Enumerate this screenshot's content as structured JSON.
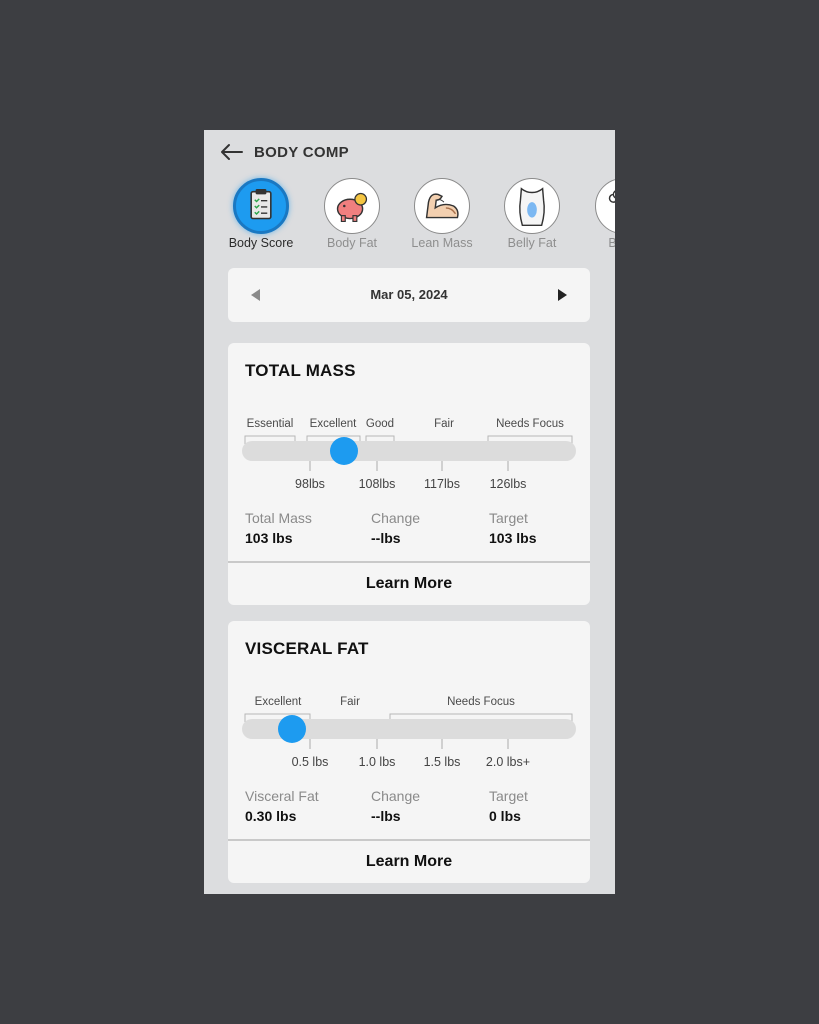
{
  "header": {
    "title": "BODY COMP",
    "back_icon": "arrow-left-icon"
  },
  "tabs": [
    {
      "label": "Body Score",
      "icon": "clipboard-checklist-icon",
      "active": true
    },
    {
      "label": "Body Fat",
      "icon": "piggy-bank-icon",
      "active": false
    },
    {
      "label": "Lean Mass",
      "icon": "flexed-arm-icon",
      "active": false
    },
    {
      "label": "Belly Fat",
      "icon": "torso-icon",
      "active": false
    },
    {
      "label": "Bone",
      "icon": "bone-icon",
      "active": false
    }
  ],
  "date_nav": {
    "date": "Mar 05, 2024",
    "prev_icon": "triangle-left-icon",
    "next_icon": "triangle-right-icon"
  },
  "total_mass": {
    "title": "TOTAL MASS",
    "zones": [
      "Essential",
      "Excellent",
      "Good",
      "Fair",
      "Needs Focus"
    ],
    "ticks": [
      "98lbs",
      "108lbs",
      "117lbs",
      "126lbs"
    ],
    "stats": [
      {
        "label": "Total Mass",
        "value": "103 lbs"
      },
      {
        "label": "Change",
        "value": "--lbs"
      },
      {
        "label": "Target",
        "value": "103 lbs"
      }
    ],
    "learn_more": "Learn More"
  },
  "visceral_fat": {
    "title": "VISCERAL FAT",
    "zones": [
      "Excellent",
      "Fair",
      "Needs Focus"
    ],
    "ticks": [
      "0.5 lbs",
      "1.0 lbs",
      "1.5 lbs",
      "2.0 lbs+"
    ],
    "stats": [
      {
        "label": "Visceral Fat",
        "value": "0.30 lbs"
      },
      {
        "label": "Change",
        "value": "--lbs"
      },
      {
        "label": "Target",
        "value": "0 lbs"
      }
    ],
    "learn_more": "Learn More"
  },
  "colors": {
    "accent": "#1d9bf0",
    "track": "#dcdcdc",
    "card": "#f5f5f5",
    "background": "#dcdddf"
  }
}
